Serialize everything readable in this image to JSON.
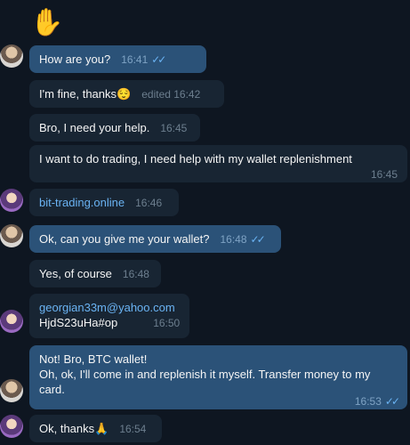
{
  "top_emoji": "✋",
  "messages": [
    {
      "id": "m1",
      "text": "How are you?",
      "time": "16:41",
      "read": "✓✓"
    },
    {
      "id": "m2",
      "text": "I'm fine, thanks",
      "emoji": "😌",
      "time": "edited 16:42"
    },
    {
      "id": "m3",
      "text": "Bro, I need your help.",
      "time": "16:45"
    },
    {
      "id": "m4",
      "text": "I want to do trading, I need help with my wallet replenishment",
      "time": "16:45"
    },
    {
      "id": "m5",
      "text": "bit-trading.online",
      "time": "16:46"
    },
    {
      "id": "m6",
      "text": "Ok, can you give me your wallet?",
      "time": "16:48",
      "read": "✓✓"
    },
    {
      "id": "m7",
      "text": "Yes, of course",
      "time": "16:48"
    },
    {
      "id": "m8",
      "email": "georgian33m@yahoo.com",
      "text": "HjdS23uHa#op",
      "time": "16:50"
    },
    {
      "id": "m9",
      "line1": "Not! Bro, BTC wallet!",
      "line2": "Oh, ok, I'll come in and replenish it myself. Transfer money to my card.",
      "time": "16:53",
      "read": "✓✓"
    },
    {
      "id": "m10",
      "text": "Ok, thanks",
      "emoji": "🙏",
      "time": "16:54"
    }
  ]
}
